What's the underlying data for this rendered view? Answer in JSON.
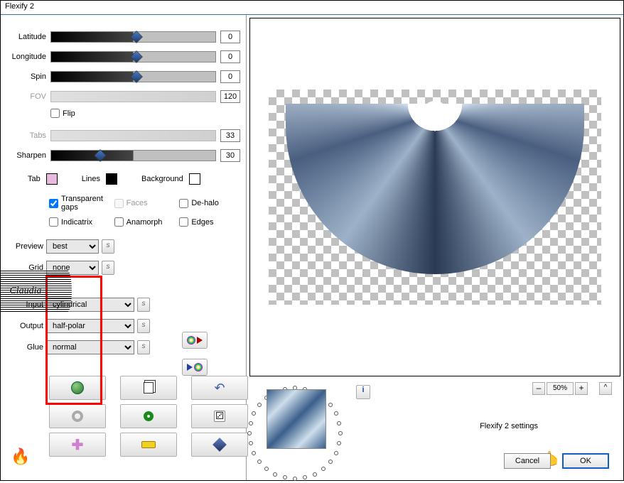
{
  "title": "Flexify 2",
  "sliders": {
    "latitude": {
      "label": "Latitude",
      "value": "0"
    },
    "longitude": {
      "label": "Longitude",
      "value": "0"
    },
    "spin": {
      "label": "Spin",
      "value": "0"
    },
    "fov": {
      "label": "FOV",
      "value": "120"
    },
    "tabs": {
      "label": "Tabs",
      "value": "33"
    },
    "sharpen": {
      "label": "Sharpen",
      "value": "30"
    }
  },
  "flip": {
    "label": "Flip",
    "checked": false
  },
  "swatches": {
    "tab": {
      "label": "Tab",
      "color": "#e8b8e0"
    },
    "lines": {
      "label": "Lines",
      "color": "#000000"
    },
    "background": {
      "label": "Background",
      "color": "#ffffff"
    }
  },
  "checks": {
    "transparent_gaps": {
      "label": "Transparent gaps",
      "checked": true
    },
    "faces": {
      "label": "Faces",
      "checked": false,
      "disabled": true
    },
    "dehalo": {
      "label": "De-halo",
      "checked": false
    },
    "indicatrix": {
      "label": "Indicatrix",
      "checked": false
    },
    "anamorph": {
      "label": "Anamorph",
      "checked": false
    },
    "edges": {
      "label": "Edges",
      "checked": false
    }
  },
  "combos": {
    "preview": {
      "label": "Preview",
      "value": "best"
    },
    "grid": {
      "label": "Grid",
      "value": "none"
    },
    "input": {
      "label": "Input",
      "value": "cylindrical"
    },
    "output": {
      "label": "Output",
      "value": "half-polar"
    },
    "glue": {
      "label": "Glue",
      "value": "normal"
    }
  },
  "zoom": {
    "minus": "–",
    "value": "50%",
    "plus": "+",
    "caret": "^"
  },
  "settings_label": "Flexify 2 settings",
  "buttons": {
    "cancel": "Cancel",
    "ok": "OK"
  },
  "s_btn": "s",
  "info": "i",
  "watermark": "Claudia"
}
